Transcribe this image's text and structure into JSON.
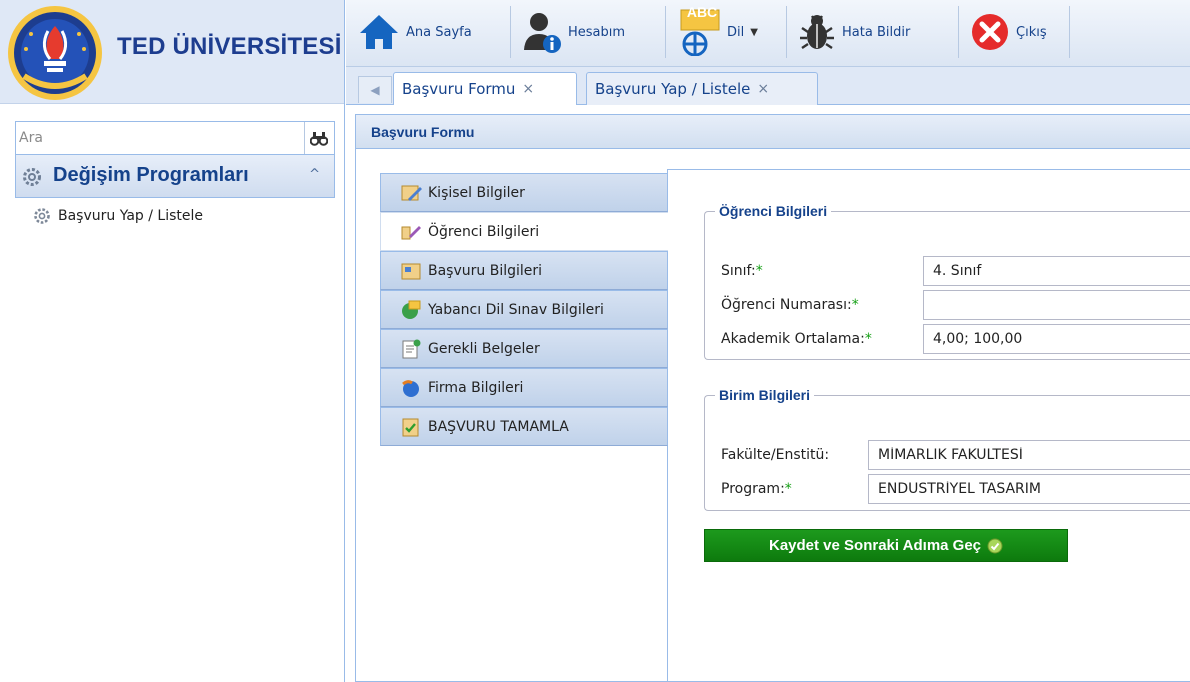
{
  "brand": {
    "name": "TED ÜNİVERSİTESİ"
  },
  "sidebar": {
    "search_placeholder": "Ara",
    "panel_title": "Değişim Programları",
    "items": [
      {
        "label": "Başvuru Yap / Listele"
      }
    ]
  },
  "toolbar": {
    "home": "Ana Sayfa",
    "account": "Hesabım",
    "lang_badge": "ABC",
    "lang": "Dil",
    "bug": "Hata Bildir",
    "logout": "Çıkış"
  },
  "tabs": [
    {
      "label": "Başvuru Formu",
      "close": "×"
    },
    {
      "label": "Başvuru Yap / Listele",
      "close": "×"
    }
  ],
  "main": {
    "title": "Başvuru Formu",
    "steps": [
      {
        "label": "Kişisel Bilgiler"
      },
      {
        "label": "Öğrenci Bilgileri"
      },
      {
        "label": "Başvuru Bilgileri"
      },
      {
        "label": "Yabancı Dil Sınav Bilgileri"
      },
      {
        "label": "Gerekli Belgeler"
      },
      {
        "label": "Firma Bilgileri"
      },
      {
        "label": "BAŞVURU TAMAMLA"
      }
    ],
    "student_section": {
      "legend": "Öğrenci Bilgileri",
      "class_label": "Sınıf:",
      "class_value": "4. Sınıf",
      "number_label": "Öğrenci Numarası:",
      "number_value": "",
      "gpa_label": "Akademik Ortalama:",
      "gpa_value": "4,00; 100,00"
    },
    "unit_section": {
      "legend": "Birim Bilgileri",
      "faculty_label": "Fakülte/Enstitü:",
      "faculty_value": "MİMARLIK FAKÜLTESİ",
      "program_label": "Program:",
      "program_value": "ENDÜSTRİYEL TASARIM"
    },
    "required_mark": "*",
    "submit_label": "Kaydet ve Sonraki Adıma Geç"
  },
  "colors": {
    "accent": "#15428b",
    "submit": "#0d7a0d",
    "required": "#15a015",
    "logout": "#e52b2b"
  }
}
